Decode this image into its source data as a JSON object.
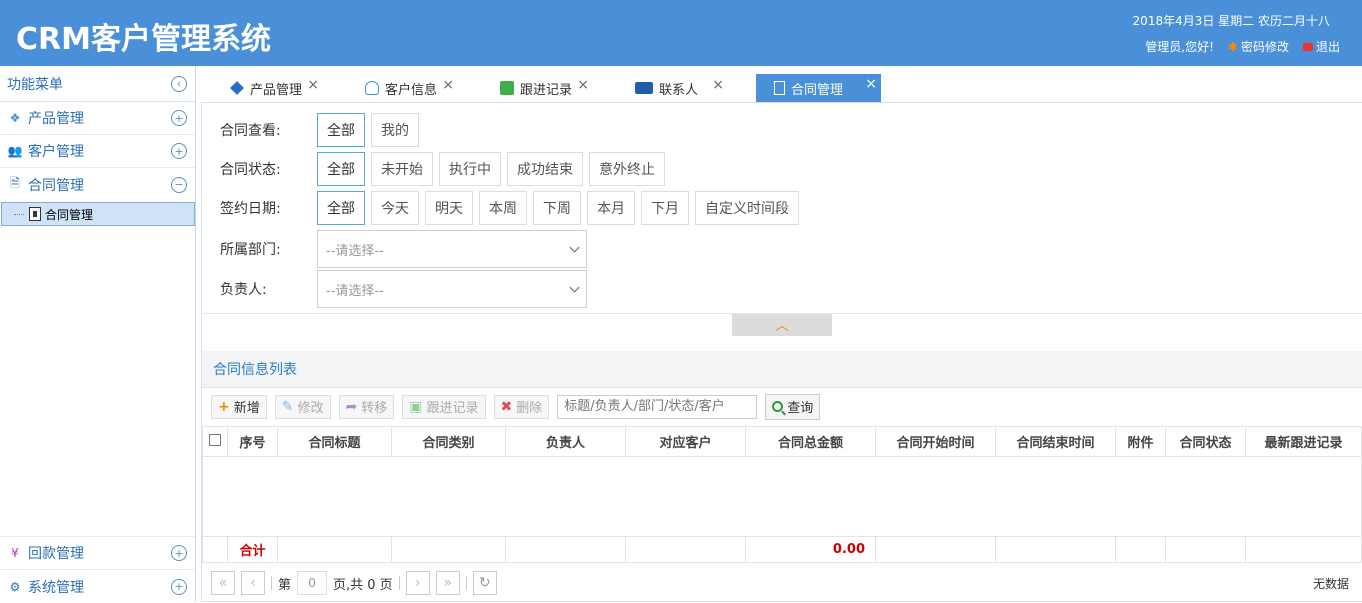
{
  "header": {
    "title": "CRM客户管理系统",
    "date": "2018年4月3日 星期二 农历二月十八",
    "greeting": "管理员,您好!",
    "change_password": "密码修改",
    "logout": "退出"
  },
  "sidebar": {
    "title": "功能菜单",
    "items": [
      {
        "label": "产品管理",
        "toggle": "+"
      },
      {
        "label": "客户管理",
        "toggle": "+"
      },
      {
        "label": "合同管理",
        "toggle": "−"
      }
    ],
    "sub_item": "合同管理",
    "bottom_items": [
      {
        "label": "回款管理",
        "toggle": "+"
      },
      {
        "label": "系统管理",
        "toggle": "+"
      }
    ]
  },
  "tabs": [
    {
      "label": "产品管理"
    },
    {
      "label": "客户信息"
    },
    {
      "label": "跟进记录"
    },
    {
      "label": "联系人"
    },
    {
      "label": "合同管理",
      "active": true
    }
  ],
  "filters": {
    "view": {
      "label": "合同查看:",
      "options": [
        "全部",
        "我的"
      ],
      "selected": "全部"
    },
    "status": {
      "label": "合同状态:",
      "options": [
        "全部",
        "未开始",
        "执行中",
        "成功结束",
        "意外终止"
      ],
      "selected": "全部"
    },
    "date": {
      "label": "签约日期:",
      "options": [
        "全部",
        "今天",
        "明天",
        "本周",
        "下周",
        "本月",
        "下月",
        "自定义时间段"
      ],
      "selected": "全部"
    },
    "department": {
      "label": "所属部门:",
      "placeholder": "--请选择--"
    },
    "owner": {
      "label": "负责人:",
      "placeholder": "--请选择--"
    }
  },
  "list": {
    "title": "合同信息列表",
    "toolbar": {
      "add": "新增",
      "edit": "修改",
      "transfer": "转移",
      "followup": "跟进记录",
      "delete": "删除",
      "search_placeholder": "标题/负责人/部门/状态/客户",
      "query": "查询"
    },
    "columns": [
      "序号",
      "合同标题",
      "合同类别",
      "负责人",
      "对应客户",
      "合同总金额",
      "合同开始时间",
      "合同结束时间",
      "附件",
      "合同状态",
      "最新跟进记录"
    ],
    "summary_label": "合计",
    "summary_total": "0.00"
  },
  "pager": {
    "page_prefix": "第",
    "page_value": "0",
    "page_suffix": "页,共 0 页",
    "no_data": "无数据"
  }
}
